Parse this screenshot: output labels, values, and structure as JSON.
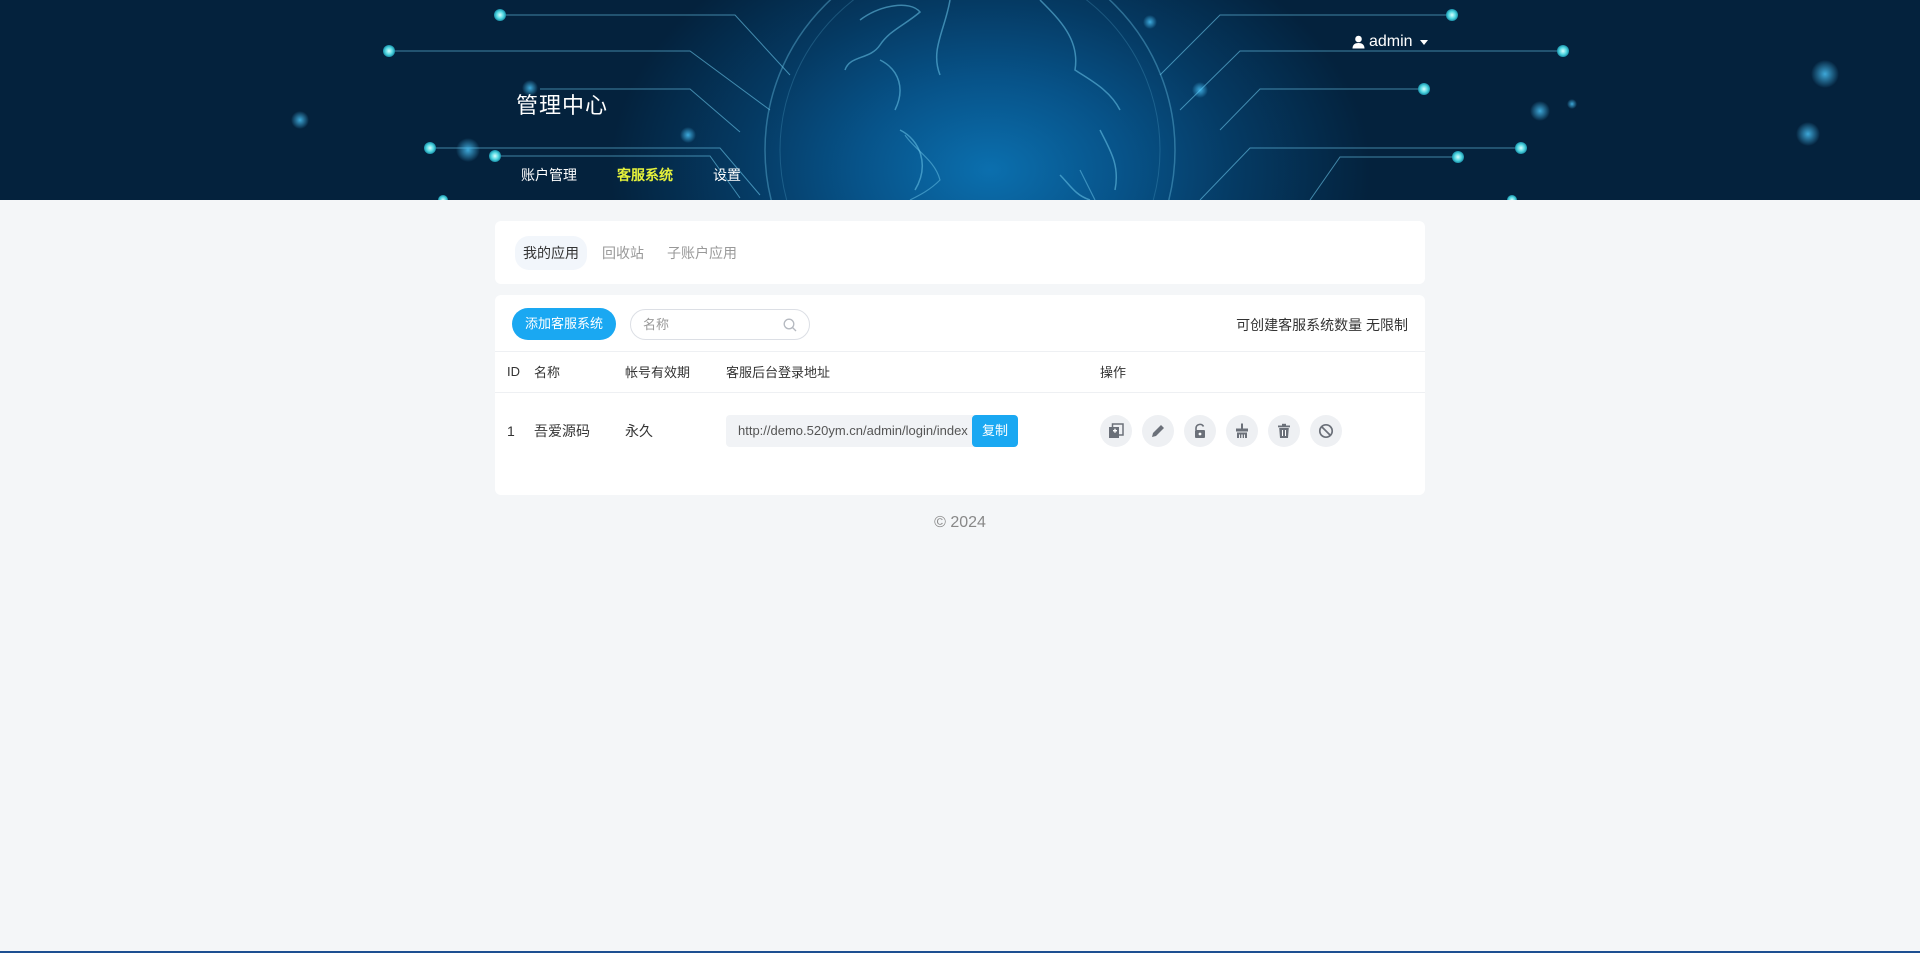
{
  "header": {
    "brand": "管理中心",
    "nav": [
      {
        "label": "账户管理",
        "active": false
      },
      {
        "label": "客服系统",
        "active": true
      },
      {
        "label": "设置",
        "active": false
      }
    ],
    "user": "admin"
  },
  "tabs": [
    {
      "label": "我的应用",
      "active": true
    },
    {
      "label": "回收站",
      "active": false
    },
    {
      "label": "子账户应用",
      "active": false
    }
  ],
  "toolbar": {
    "add_label": "添加客服系统",
    "search_placeholder": "名称",
    "quota_text": "可创建客服系统数量 无限制"
  },
  "table": {
    "headers": [
      "ID",
      "名称",
      "帐号有效期",
      "客服后台登录地址",
      "操作"
    ],
    "rows": [
      {
        "id": "1",
        "name": "吾爱源码",
        "expiry": "永久",
        "url": "http://demo.520ym.cn/admin/login/index",
        "copy_label": "复制"
      }
    ],
    "actions": [
      "copy-icon",
      "edit-icon",
      "unlock-icon",
      "broom-icon",
      "trash-icon",
      "disable-icon"
    ]
  },
  "footer": "© 2024",
  "colors": {
    "accent": "#1aa8f2",
    "nav_active": "#e5f23b",
    "header_dark": "#04223d",
    "page_bg": "#f4f6f8"
  }
}
